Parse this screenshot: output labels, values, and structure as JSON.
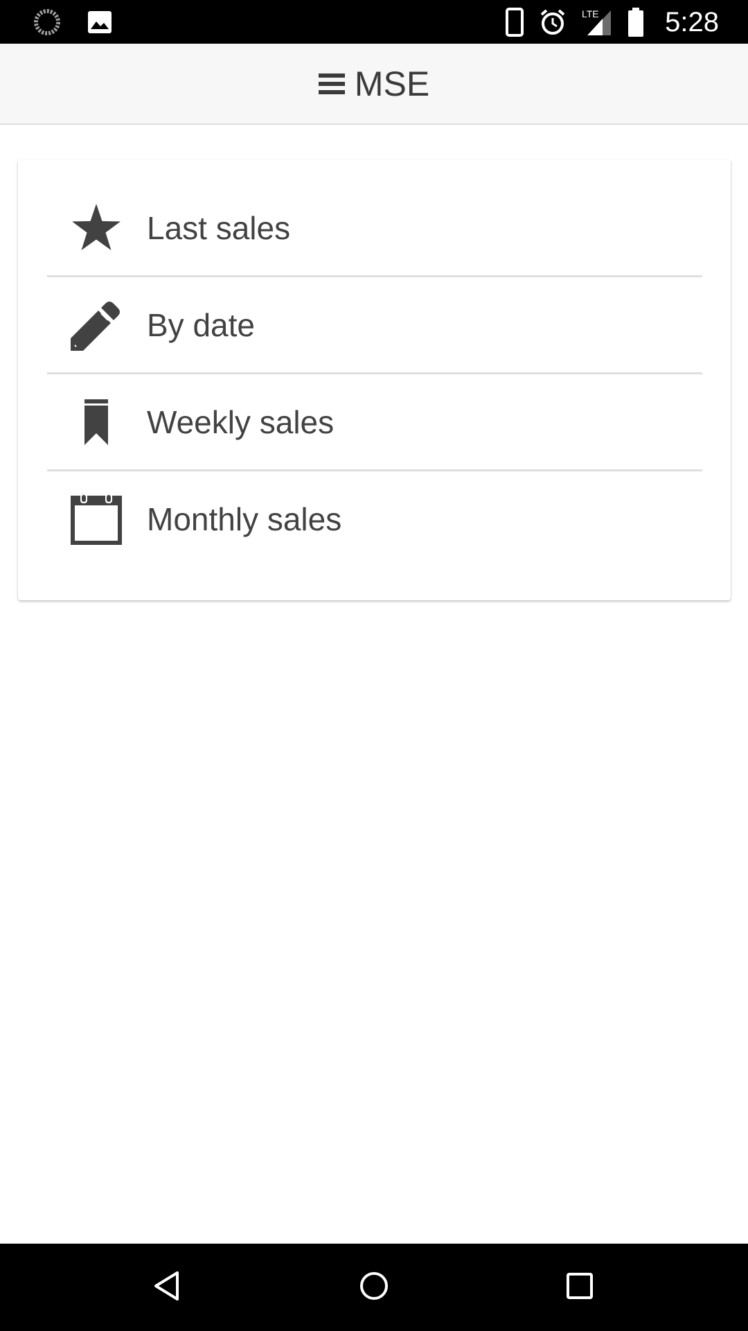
{
  "status_bar": {
    "time": "5:28",
    "network": "LTE",
    "icons": [
      "sync-icon",
      "image-icon",
      "phone-icon",
      "alarm-icon",
      "signal-icon",
      "battery-icon"
    ]
  },
  "app_bar": {
    "title": "MSE",
    "menu_icon": "hamburger-menu-icon"
  },
  "menu": {
    "items": [
      {
        "label": "Last sales",
        "icon": "star-icon"
      },
      {
        "label": "By date",
        "icon": "pencil-icon"
      },
      {
        "label": "Weekly sales",
        "icon": "bookmark-icon"
      },
      {
        "label": "Monthly sales",
        "icon": "calendar-icon"
      }
    ]
  },
  "nav_bar": {
    "icons": [
      "back-icon",
      "home-icon",
      "recents-icon"
    ]
  },
  "colors": {
    "status_bar": "#000000",
    "app_bar": "#f7f7f7",
    "text": "#424242",
    "divider": "#dedede"
  }
}
